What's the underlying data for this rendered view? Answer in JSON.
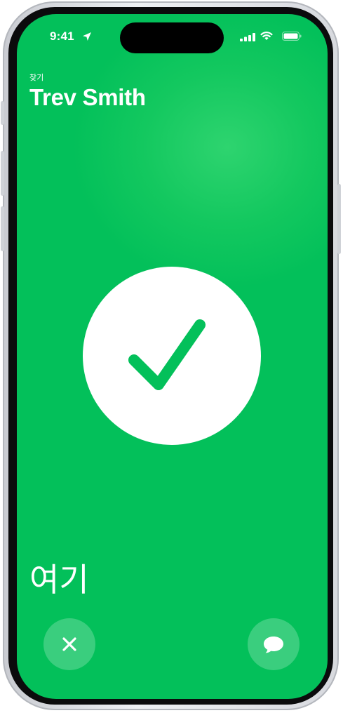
{
  "status_bar": {
    "time": "9:41",
    "icons": [
      "location-arrow-icon",
      "signal-icon",
      "wifi-icon",
      "battery-icon"
    ]
  },
  "header": {
    "subtitle": "찾기",
    "title": "Trev Smith"
  },
  "main": {
    "status_icon": "checkmark-icon",
    "status_text": "여기"
  },
  "controls": {
    "close_icon": "close-icon",
    "message_icon": "message-bubble-icon"
  },
  "colors": {
    "background": "#03C05A",
    "accent": "#13C85F",
    "check": "#03C05A"
  }
}
